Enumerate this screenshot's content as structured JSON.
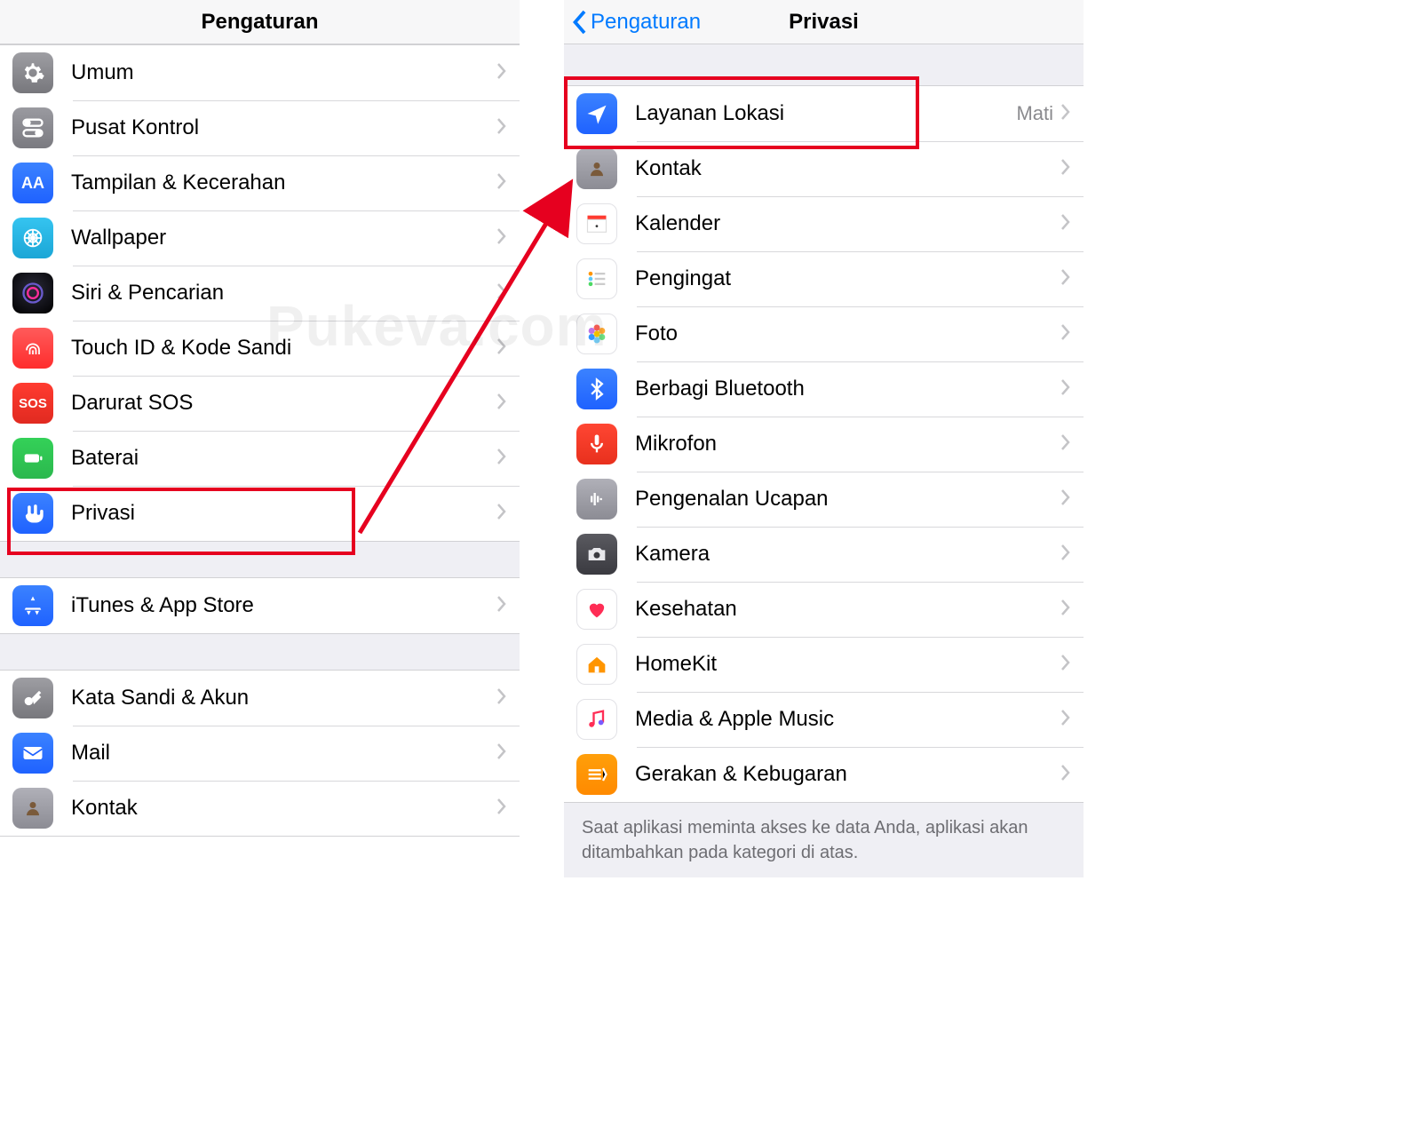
{
  "left": {
    "title": "Pengaturan",
    "groups": [
      [
        {
          "key": "umum",
          "label": "Umum"
        },
        {
          "key": "pusat-kontrol",
          "label": "Pusat Kontrol"
        },
        {
          "key": "tampilan",
          "label": "Tampilan & Kecerahan"
        },
        {
          "key": "wallpaper",
          "label": "Wallpaper"
        },
        {
          "key": "siri",
          "label": "Siri & Pencarian"
        },
        {
          "key": "touchid",
          "label": "Touch ID & Kode Sandi"
        },
        {
          "key": "sos",
          "label": "Darurat SOS"
        },
        {
          "key": "baterai",
          "label": "Baterai"
        },
        {
          "key": "privasi",
          "label": "Privasi"
        }
      ],
      [
        {
          "key": "itunes",
          "label": "iTunes & App Store"
        }
      ],
      [
        {
          "key": "sandi",
          "label": "Kata Sandi & Akun"
        },
        {
          "key": "mail",
          "label": "Mail"
        },
        {
          "key": "kontak",
          "label": "Kontak"
        }
      ]
    ]
  },
  "right": {
    "back": "Pengaturan",
    "title": "Privasi",
    "items": [
      {
        "key": "lokasi",
        "label": "Layanan Lokasi",
        "value": "Mati"
      },
      {
        "key": "kontak",
        "label": "Kontak"
      },
      {
        "key": "kalender",
        "label": "Kalender"
      },
      {
        "key": "pengingat",
        "label": "Pengingat"
      },
      {
        "key": "foto",
        "label": "Foto"
      },
      {
        "key": "bluetooth",
        "label": "Berbagi Bluetooth"
      },
      {
        "key": "mikrofon",
        "label": "Mikrofon"
      },
      {
        "key": "ucapan",
        "label": "Pengenalan Ucapan"
      },
      {
        "key": "kamera",
        "label": "Kamera"
      },
      {
        "key": "kesehatan",
        "label": "Kesehatan"
      },
      {
        "key": "homekit",
        "label": "HomeKit"
      },
      {
        "key": "media",
        "label": "Media & Apple Music"
      },
      {
        "key": "gerakan",
        "label": "Gerakan & Kebugaran"
      }
    ],
    "footer": "Saat aplikasi meminta akses ke data Anda, aplikasi akan ditambahkan pada kategori di atas."
  },
  "watermark": "Pukeva.com"
}
